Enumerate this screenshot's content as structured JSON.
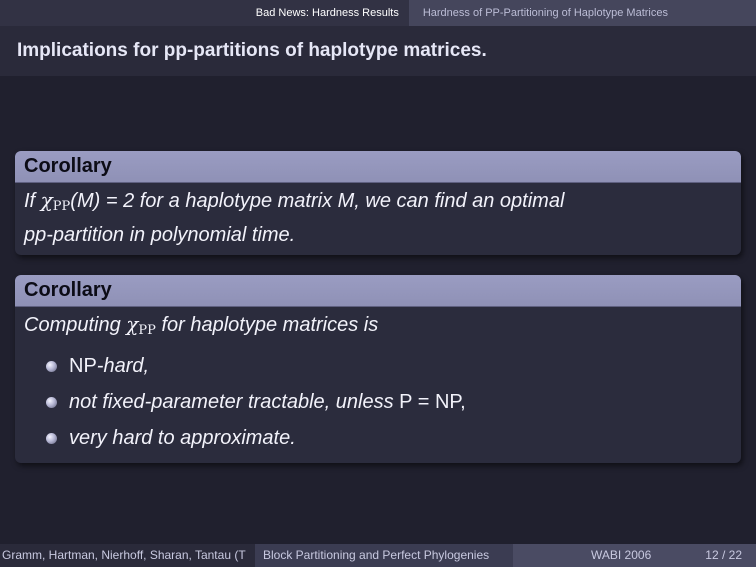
{
  "header": {
    "section": "Bad News: Hardness Results",
    "subsection": "Hardness of PP-Partitioning of Haplotype Matrices"
  },
  "frame": {
    "title": "Implications for pp-partitions of haplotype matrices."
  },
  "block1": {
    "title": "Corollary",
    "text_if": "If ",
    "chi": "χ",
    "chi_sub": "PP",
    "text_mid": "(M) = 2 for a haplotype matrix M, we can find an optimal",
    "text_line2": "pp-partition in polynomial time."
  },
  "block2": {
    "title": "Corollary",
    "intro_pre": "Computing ",
    "chi": "χ",
    "chi_sub": "PP",
    "intro_post": " for haplotype matrices is",
    "items": [
      {
        "np": "NP",
        "text": "-hard,"
      },
      {
        "text": "not fixed-parameter tractable, unless ",
        "eq": "P = NP",
        "end": ","
      },
      {
        "text": "very hard to approximate."
      }
    ]
  },
  "footer": {
    "authors": "Gramm, Hartman, Nierhoff, Sharan, Tantau (T",
    "talk_title": "Block Partitioning and Perfect Phylogenies",
    "event": "WABI 2006",
    "page": "12 / 22"
  }
}
